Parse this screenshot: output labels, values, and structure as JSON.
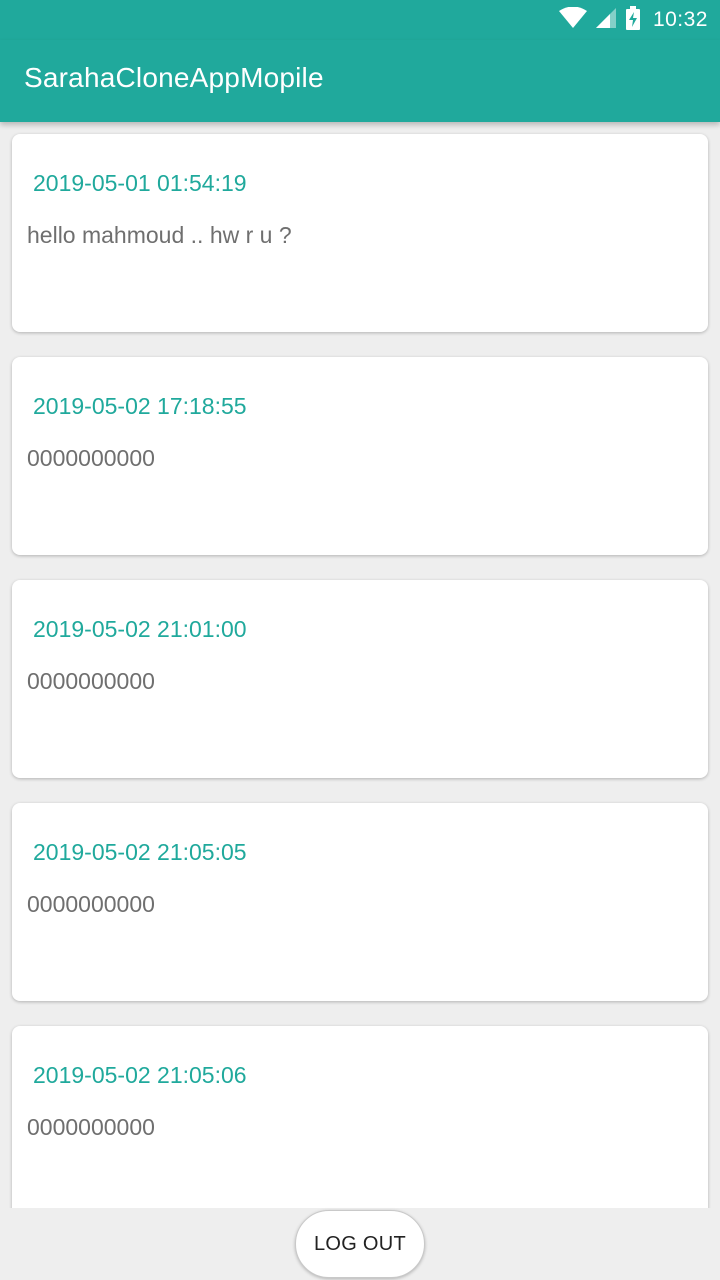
{
  "status_bar": {
    "time": "10:32",
    "icons": [
      "wifi-icon",
      "cell-signal-icon",
      "battery-charging-icon"
    ]
  },
  "app_bar": {
    "title": "SarahaCloneAppMopile"
  },
  "messages": [
    {
      "date": "2019-05-01 01:54:19",
      "text": "hello mahmoud .. hw r u ?"
    },
    {
      "date": "2019-05-02 17:18:55",
      "text": "0000000000"
    },
    {
      "date": "2019-05-02 21:01:00",
      "text": "0000000000"
    },
    {
      "date": "2019-05-02 21:05:05",
      "text": "0000000000"
    },
    {
      "date": "2019-05-02 21:05:06",
      "text": "0000000000"
    }
  ],
  "logout_button": {
    "label": "LOG OUT"
  },
  "colors": {
    "primary": "#20a99c",
    "background": "#eeeeee",
    "card": "#ffffff",
    "message_text": "#6f6f6f"
  }
}
